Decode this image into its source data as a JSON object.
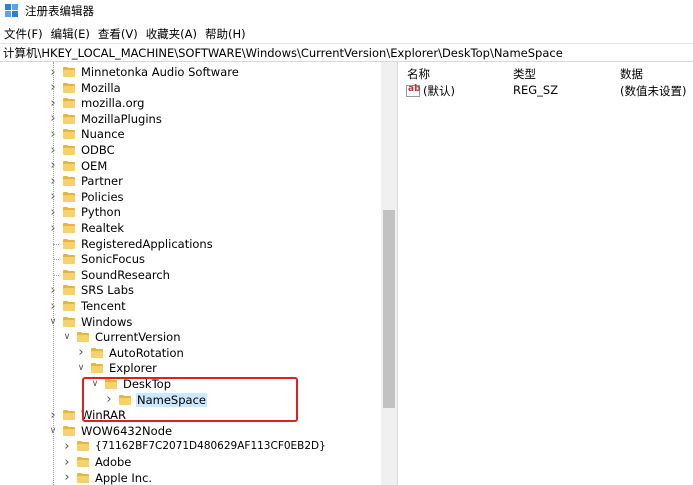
{
  "window": {
    "title": "注册表编辑器",
    "icon": "regedit-icon"
  },
  "menu": [
    {
      "label": "文件(F)"
    },
    {
      "label": "编辑(E)"
    },
    {
      "label": "查看(V)"
    },
    {
      "label": "收藏夹(A)"
    },
    {
      "label": "帮助(H)"
    }
  ],
  "address": "计算机\\HKEY_LOCAL_MACHINE\\SOFTWARE\\Windows\\CurrentVersion\\Explorer\\DeskTop\\NameSpace",
  "tree": {
    "items": [
      {
        "label": "Minnetonka Audio Software",
        "arrow": "right"
      },
      {
        "label": "Mozilla",
        "arrow": "right"
      },
      {
        "label": "mozilla.org",
        "arrow": "right"
      },
      {
        "label": "MozillaPlugins",
        "arrow": "right"
      },
      {
        "label": "Nuance",
        "arrow": "right"
      },
      {
        "label": "ODBC",
        "arrow": "right"
      },
      {
        "label": "OEM",
        "arrow": "right"
      },
      {
        "label": "Partner",
        "arrow": "right"
      },
      {
        "label": "Policies",
        "arrow": "right"
      },
      {
        "label": "Python",
        "arrow": "right"
      },
      {
        "label": "Realtek",
        "arrow": "right"
      },
      {
        "label": "RegisteredApplications",
        "arrow": "none"
      },
      {
        "label": "SonicFocus",
        "arrow": "none"
      },
      {
        "label": "SoundResearch",
        "arrow": "none"
      },
      {
        "label": "SRS Labs",
        "arrow": "right"
      },
      {
        "label": "Tencent",
        "arrow": "right"
      },
      {
        "label": "Windows",
        "arrow": "down"
      },
      {
        "label": "CurrentVersion",
        "arrow": "down"
      },
      {
        "label": "AutoRotation",
        "arrow": "right"
      },
      {
        "label": "Explorer",
        "arrow": "down"
      },
      {
        "label": "DeskTop",
        "arrow": "down"
      },
      {
        "label": "NameSpace",
        "arrow": "right",
        "selected": true
      },
      {
        "label": "WinRAR",
        "arrow": "right"
      },
      {
        "label": "WOW6432Node",
        "arrow": "down"
      },
      {
        "label": "{71162BF7C2071D480629AF113CF0EB2D}",
        "arrow": "right"
      },
      {
        "label": "Adobe",
        "arrow": "right"
      },
      {
        "label": "Apple Inc.",
        "arrow": "right"
      }
    ]
  },
  "list": {
    "columns": [
      "名称",
      "类型",
      "数据"
    ],
    "rows": [
      {
        "name": "(默认)",
        "type": "REG_SZ",
        "data": "(数值未设置)",
        "icon": "string-value-icon",
        "icon_text": "ab"
      }
    ]
  },
  "colors": {
    "folder": "#f7d16b",
    "selection": "#cce8ff",
    "highlight_box": "#e02020"
  }
}
